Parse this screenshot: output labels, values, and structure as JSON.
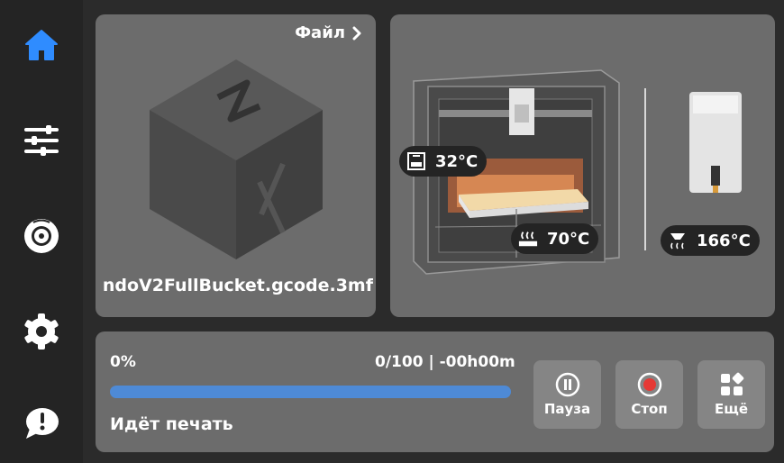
{
  "sidebar": {
    "items": [
      {
        "icon": "home-icon",
        "active": true
      },
      {
        "icon": "sliders-icon"
      },
      {
        "icon": "filament-spool-icon"
      },
      {
        "icon": "gear-icon"
      },
      {
        "icon": "info-bubble-icon"
      }
    ]
  },
  "file_panel": {
    "link_label": "Файл",
    "file_name": "ndoV2FullBucket.gcode.3mf"
  },
  "printer_panel": {
    "chamber_temp": "32°C",
    "bed_temp": "70°C",
    "nozzle_temp": "166°C"
  },
  "progress": {
    "percent_label": "0%",
    "fill_fraction": 0.0,
    "info_label": "0/100 | -00h00m",
    "status": "Идёт печать"
  },
  "actions": {
    "pause_label": "Пауза",
    "stop_label": "Стоп",
    "more_label": "Ещё"
  },
  "colors": {
    "accent_blue": "#4e8ad6",
    "active_icon": "#2f8cff",
    "stop_red": "#e53935",
    "panel_bg": "#6c6c6c"
  }
}
